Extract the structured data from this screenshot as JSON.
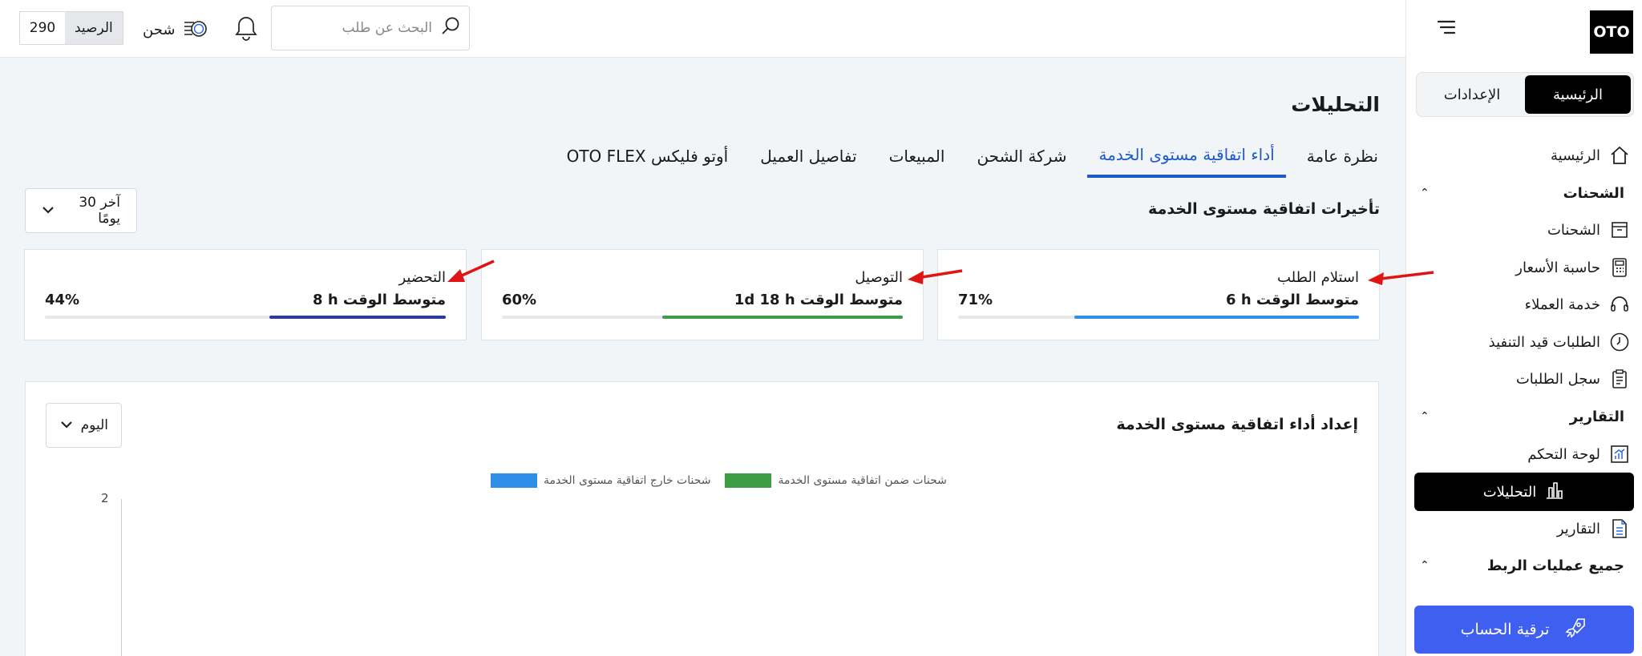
{
  "sidebar": {
    "logo": "OTO",
    "segment": {
      "home": "الرئيسية",
      "settings": "الإعدادات"
    },
    "items": {
      "home": "الرئيسية",
      "shipments_group": "الشحنات",
      "shipments": "الشحنات",
      "price_calculator": "حاسبة الأسعار",
      "customer_service": "خدمة العملاء",
      "pending_orders": "الطلبات قيد التنفيذ",
      "orders_log": "سجل الطلبات",
      "reports_group": "التقارير",
      "dashboard": "لوحة التحكم",
      "analytics": "التحليلات",
      "reports": "التقارير",
      "integrations_group": "جميع عمليات الربط"
    },
    "upgrade": "ترقية الحساب"
  },
  "topbar": {
    "search_placeholder": "البحث عن طلب",
    "ship_label": "شحن",
    "balance_label": "الرصيد",
    "balance_value": "290"
  },
  "main": {
    "title": "التحليلات",
    "tabs": [
      "نظرة عامة",
      "أداء اتفاقية مستوى الخدمة",
      "شركة الشحن",
      "المبيعات",
      "تفاصيل العميل",
      "أوتو فليكس OTO FLEX"
    ],
    "section_title": "تأخيرات اتفاقية مستوى الخدمة",
    "range_dropdown": "آخر 30 يومًا",
    "cards": [
      {
        "title": "استلام الطلب",
        "avg_label": "متوسط الوقت",
        "avg_value": "6 h",
        "percent": "71%",
        "fill": 0.71,
        "color": "#2f8fe8"
      },
      {
        "title": "التوصيل",
        "avg_label": "متوسط الوقت",
        "avg_value": "1d 18 h",
        "percent": "60%",
        "fill": 0.6,
        "color": "#3c9d45"
      },
      {
        "title": "التحضير",
        "avg_label": "متوسط الوقت",
        "avg_value": "8 h",
        "percent": "44%",
        "fill": 0.44,
        "color": "#2b3a9e"
      }
    ],
    "chart_card": {
      "title": "إعداد أداء اتفاقية مستوى الخدمة",
      "dropdown": "اليوم",
      "legend": [
        {
          "label": "شحنات ضمن اتفاقية مستوى الخدمة",
          "color": "#3c9d45"
        },
        {
          "label": "شحنات خارج اتفاقية مستوى الخدمة",
          "color": "#2f8fe8"
        }
      ],
      "y_tick": "2"
    }
  },
  "colors": {
    "accent": "#1e5bc7",
    "upgrade": "#3f5ff0",
    "arrow": "#e01414"
  }
}
